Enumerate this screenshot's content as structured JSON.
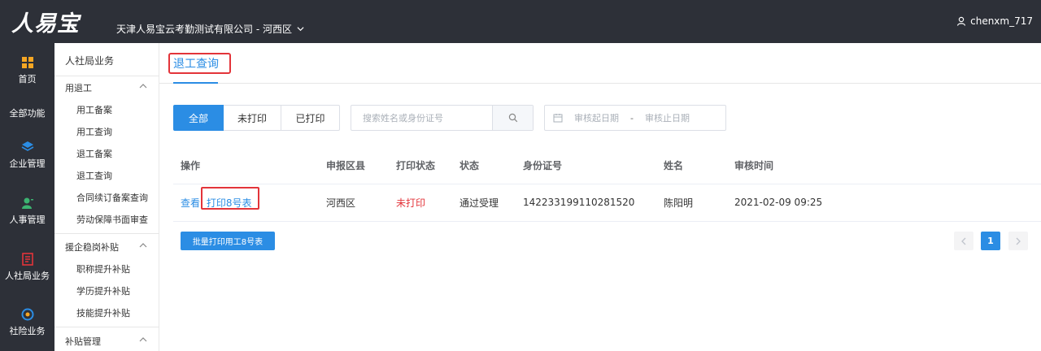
{
  "topbar": {
    "logo": "人易宝",
    "company": "天津人易宝云考勤测试有限公司 - 河西区",
    "username": "chenxm_717"
  },
  "leftnav": [
    {
      "label": "首页",
      "icon": "home-grid-icon",
      "color": "#f5a623"
    },
    {
      "label": "全部功能"
    },
    {
      "label": "企业管理",
      "icon": "layers-icon",
      "color": "#2b8de4"
    },
    {
      "label": "人事管理",
      "icon": "person-icon",
      "color": "#3cb371"
    },
    {
      "label": "人社局业务",
      "icon": "document-icon",
      "color": "#e3343a"
    },
    {
      "label": "社险业务",
      "icon": "shield-icon",
      "color": "#2b8de4"
    }
  ],
  "sidebar": {
    "title": "人社局业务",
    "groups": [
      {
        "label": "用退工",
        "items": [
          "用工备案",
          "用工查询",
          "退工备案",
          "退工查询",
          "合同续订备案查询",
          "劳动保障书面审查"
        ]
      },
      {
        "label": "援企稳岗补贴",
        "items": [
          "职称提升补贴",
          "学历提升补贴",
          "技能提升补贴"
        ]
      },
      {
        "label": "补贴管理",
        "items": []
      }
    ]
  },
  "tab": {
    "active_label": "退工查询"
  },
  "filters": {
    "all": "全部",
    "unprinted": "未打印",
    "printed": "已打印"
  },
  "search": {
    "placeholder": "搜索姓名或身份证号"
  },
  "daterange": {
    "start_placeholder": "审核起日期",
    "separator": "-",
    "end_placeholder": "审核止日期"
  },
  "table": {
    "headers": [
      "操作",
      "申报区县",
      "打印状态",
      "状态",
      "身份证号",
      "姓名",
      "审核时间"
    ],
    "rows": [
      {
        "view": "查看",
        "print": "打印8号表",
        "district": "河西区",
        "print_status": "未打印",
        "status": "通过受理",
        "id_number": "142233199110281520",
        "name": "陈阳明",
        "review_time": "2021-02-09 09:25"
      }
    ]
  },
  "batch_print": "批量打印用工8号表",
  "pagination": {
    "current": "1"
  },
  "colors": {
    "primary": "#2b8de4",
    "nav_bg": "#2d3038",
    "alert": "#e3343a"
  }
}
